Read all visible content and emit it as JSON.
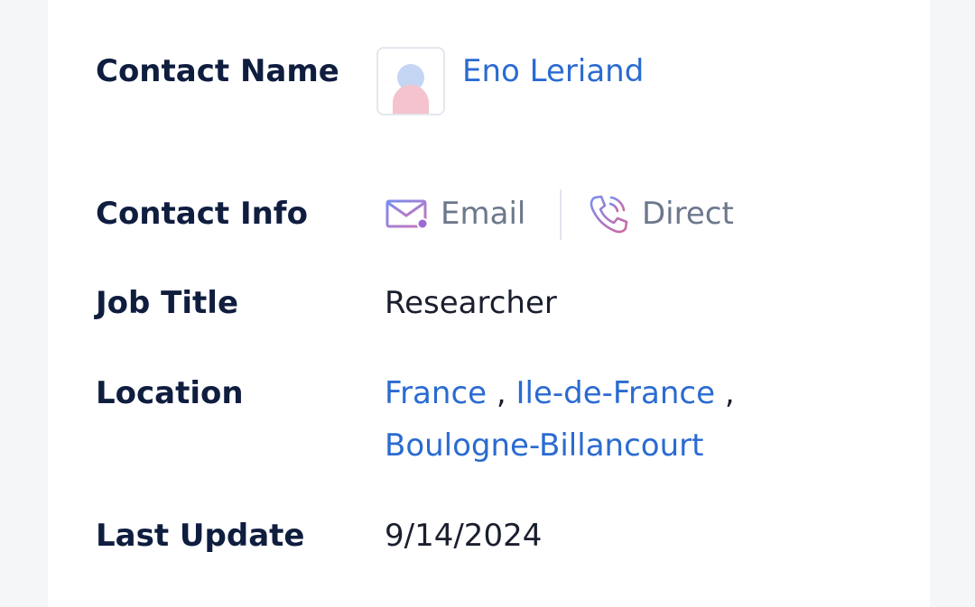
{
  "contact": {
    "labels": {
      "name": "Contact Name",
      "info": "Contact Info",
      "job_title": "Job Title",
      "location": "Location",
      "last_update": "Last Update"
    },
    "name": "Eno Leriand",
    "info": {
      "email_label": "Email",
      "direct_label": "Direct",
      "email_icon": "envelope-icon",
      "direct_icon": "phone-icon"
    },
    "job_title": "Researcher",
    "location": {
      "country": "France",
      "region": "Ile-de-France",
      "city": "Boulogne-Billancourt",
      "separator": ","
    },
    "last_update": "9/14/2024"
  },
  "colors": {
    "label": "#0f1d3f",
    "link": "#2a6bd1",
    "muted": "#6d788c",
    "background": "#f5f6f8",
    "card": "#ffffff"
  }
}
